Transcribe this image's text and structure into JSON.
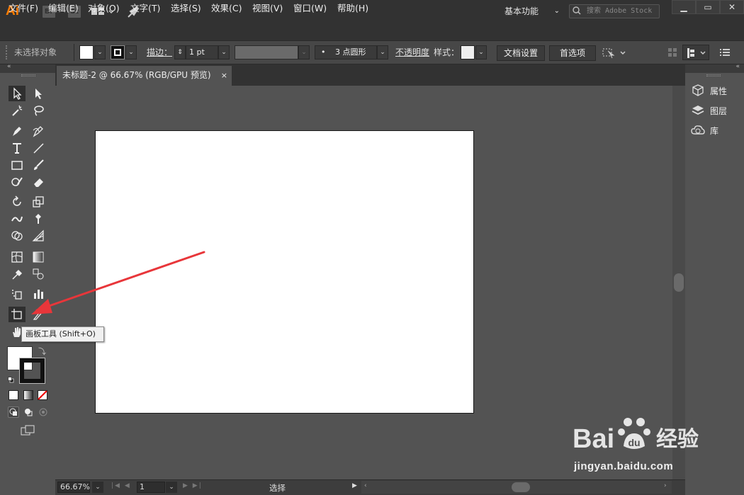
{
  "app": {
    "logo": "Ai",
    "badges": [
      "Br",
      "St"
    ]
  },
  "titlebar": {
    "workspace": "基本功能",
    "search_placeholder": "搜索 Adobe Stock",
    "window_controls": [
      "minimize",
      "maximize",
      "close"
    ]
  },
  "menu": [
    "文件(F)",
    "编辑(E)",
    "对象(O)",
    "文字(T)",
    "选择(S)",
    "效果(C)",
    "视图(V)",
    "窗口(W)",
    "帮助(H)"
  ],
  "control": {
    "selection_status": "未选择对象",
    "stroke_label": "描边：",
    "stroke_value": "1 pt",
    "brush_value": "3 点圆形",
    "opacity_label": "不透明度",
    "style_label": "样式：",
    "doc_setup": "文档设置",
    "preferences": "首选项"
  },
  "document": {
    "tab_title": "未标题-2 @ 66.67% (RGB/GPU 预览)",
    "close": "×"
  },
  "tooltip": "画板工具 (Shift+O)",
  "right_panel": {
    "items": [
      "属性",
      "图层",
      "库"
    ]
  },
  "status": {
    "zoom": "66.67%",
    "artboard_num": "1",
    "tool": "选择"
  },
  "watermark": {
    "text": "Bai",
    "text2": "经验",
    "url": "jingyan.baidu.com"
  },
  "colors": {
    "accent": "#ff7c00",
    "arrow": "#e8363a",
    "panel": "#535353",
    "dark": "#323232"
  }
}
